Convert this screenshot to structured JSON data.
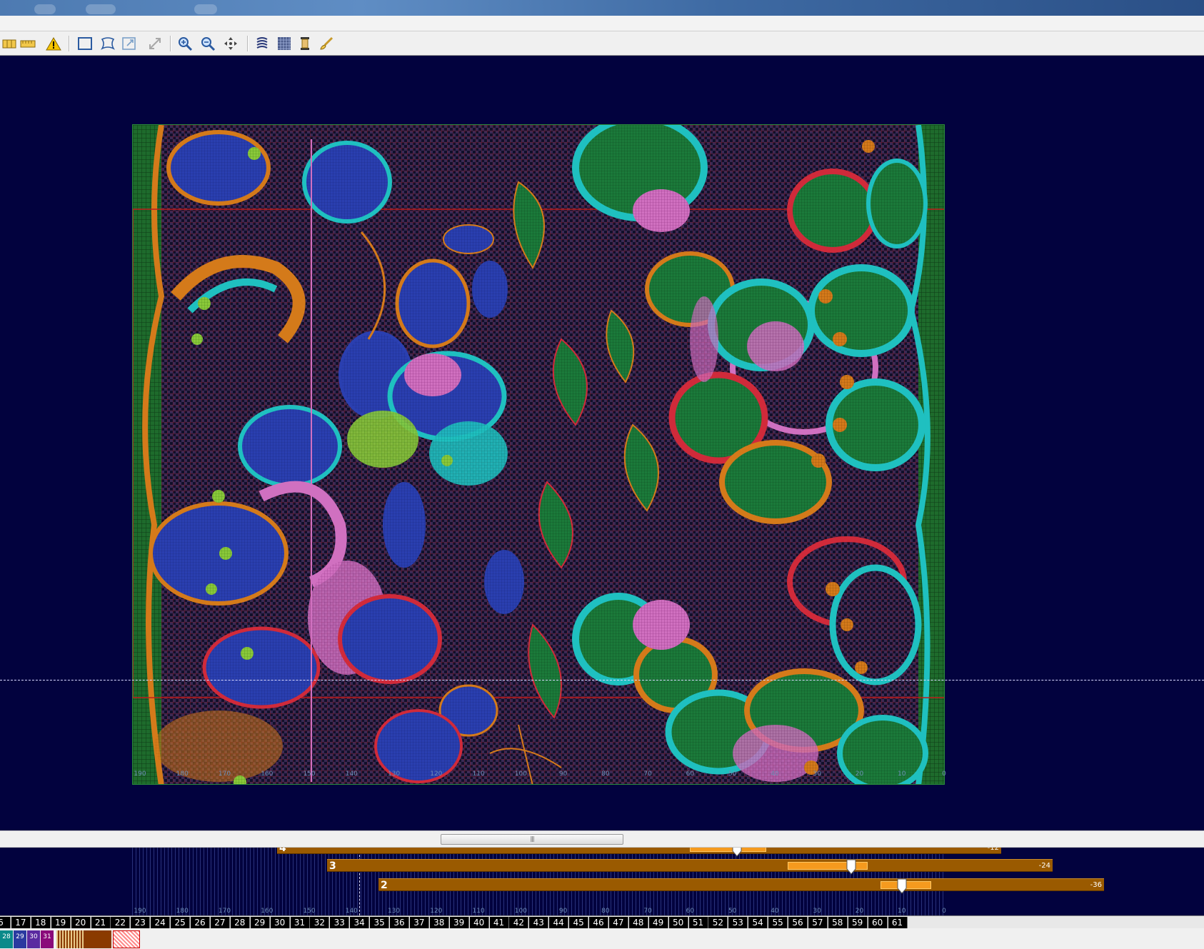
{
  "toolbar": {
    "buttons": [
      "columns-icon",
      "ruler-icon",
      "warning-icon",
      "select-rect-icon",
      "select-free-icon",
      "transform-icon",
      "expand-icon",
      "zoom-in-icon",
      "zoom-out-icon",
      "pan-icon",
      "yarn-icon",
      "pattern-icon",
      "bobbin-icon",
      "brush-icon"
    ]
  },
  "ruler": {
    "labels": [
      "190",
      "180",
      "170",
      "160",
      "150",
      "140",
      "130",
      "120",
      "110",
      "100",
      "90",
      "80",
      "70",
      "60",
      "50",
      "40",
      "30",
      "20",
      "10",
      "0"
    ]
  },
  "bars": [
    {
      "number": "4",
      "value": "-12",
      "range_from": 60,
      "range_to": 42,
      "handle": 49
    },
    {
      "number": "3",
      "value": "-24",
      "range_from": 37,
      "range_to": 18,
      "handle": 22
    },
    {
      "number": "2",
      "value": "-36",
      "range_from": 15,
      "range_to": 3,
      "handle": 10
    }
  ],
  "bar_numbers": [
    "6",
    "17",
    "18",
    "19",
    "20",
    "21",
    "22",
    "23",
    "24",
    "25",
    "26",
    "27",
    "28",
    "29",
    "30",
    "31",
    "32",
    "33",
    "34",
    "35",
    "36",
    "37",
    "38",
    "39",
    "40",
    "41",
    "42",
    "43",
    "44",
    "45",
    "46",
    "47",
    "48",
    "49",
    "50",
    "51",
    "52",
    "53",
    "54",
    "55",
    "56",
    "57",
    "58",
    "59",
    "60",
    "61"
  ],
  "palette": [
    {
      "label": "28",
      "color": "#0a8a8a"
    },
    {
      "label": "29",
      "color": "#2a3aa0"
    },
    {
      "label": "30",
      "color": "#5a2aa0"
    },
    {
      "label": "31",
      "color": "#8a0a7a"
    }
  ],
  "colors": {
    "background": "#02023e",
    "ground": "#1a6a2a",
    "bar": "#9a5a00",
    "bar_range": "#f59a1e"
  }
}
